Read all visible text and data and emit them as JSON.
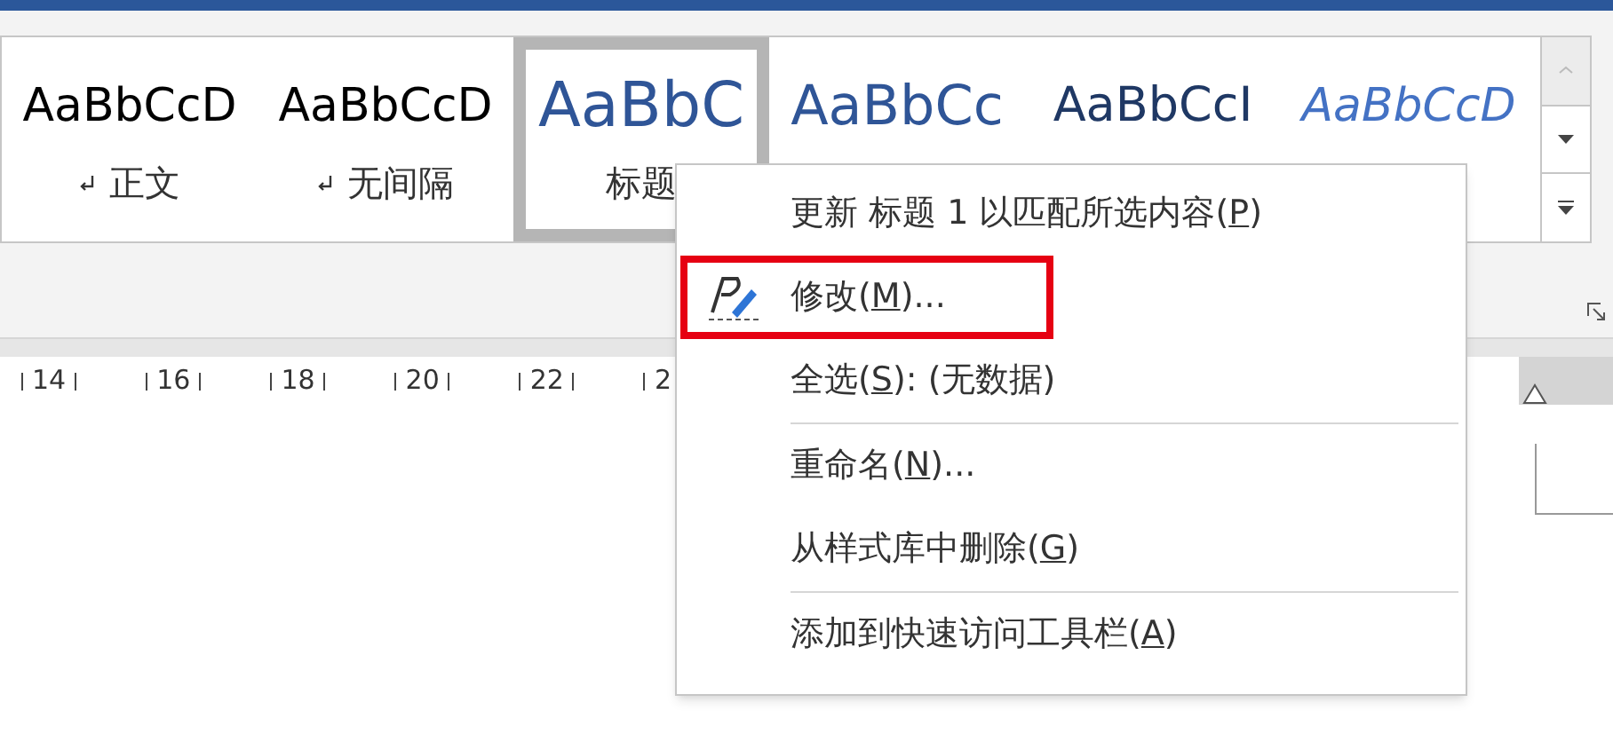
{
  "styles_gallery": {
    "items": [
      {
        "sample": "AaBbCcD",
        "kind": "normal",
        "label": "正文",
        "paragraph_mark": true,
        "selected": false
      },
      {
        "sample": "AaBbCcD",
        "kind": "normal",
        "label": "无间隔",
        "paragraph_mark": true,
        "selected": false
      },
      {
        "sample": "AaBbC",
        "kind": "heading1",
        "label": "标题",
        "paragraph_mark": false,
        "selected": true
      },
      {
        "sample": "AaBbCc",
        "kind": "heading2",
        "selected": false
      },
      {
        "sample": "AaBbCcI",
        "kind": "title",
        "selected": false
      },
      {
        "sample": "AaBbCcD",
        "kind": "subtitle",
        "selected": false
      }
    ],
    "scroll_up_disabled": true
  },
  "ruler": {
    "labels": [
      "14",
      "16",
      "18",
      "20",
      "22",
      "2"
    ]
  },
  "context_menu": {
    "items": [
      {
        "kind": "item",
        "text": "更新 标题 1 以匹配所选内容(",
        "mnemonic": "P",
        "suffix": ")",
        "highlighted": false
      },
      {
        "kind": "pen_item",
        "text": "修改(",
        "mnemonic": "M",
        "suffix": ")...",
        "highlighted": true
      },
      {
        "kind": "item",
        "text": "全选(",
        "mnemonic": "S",
        "suffix": "): (无数据)",
        "highlighted": false
      },
      {
        "kind": "separator"
      },
      {
        "kind": "item",
        "text": "重命名(",
        "mnemonic": "N",
        "suffix": ")...",
        "highlighted": false
      },
      {
        "kind": "item",
        "text": "从样式库中删除(",
        "mnemonic": "G",
        "suffix": ")",
        "highlighted": false
      },
      {
        "kind": "separator"
      },
      {
        "kind": "item",
        "text": "添加到快速访问工具栏(",
        "mnemonic": "A",
        "suffix": ")",
        "highlighted": false
      }
    ]
  }
}
